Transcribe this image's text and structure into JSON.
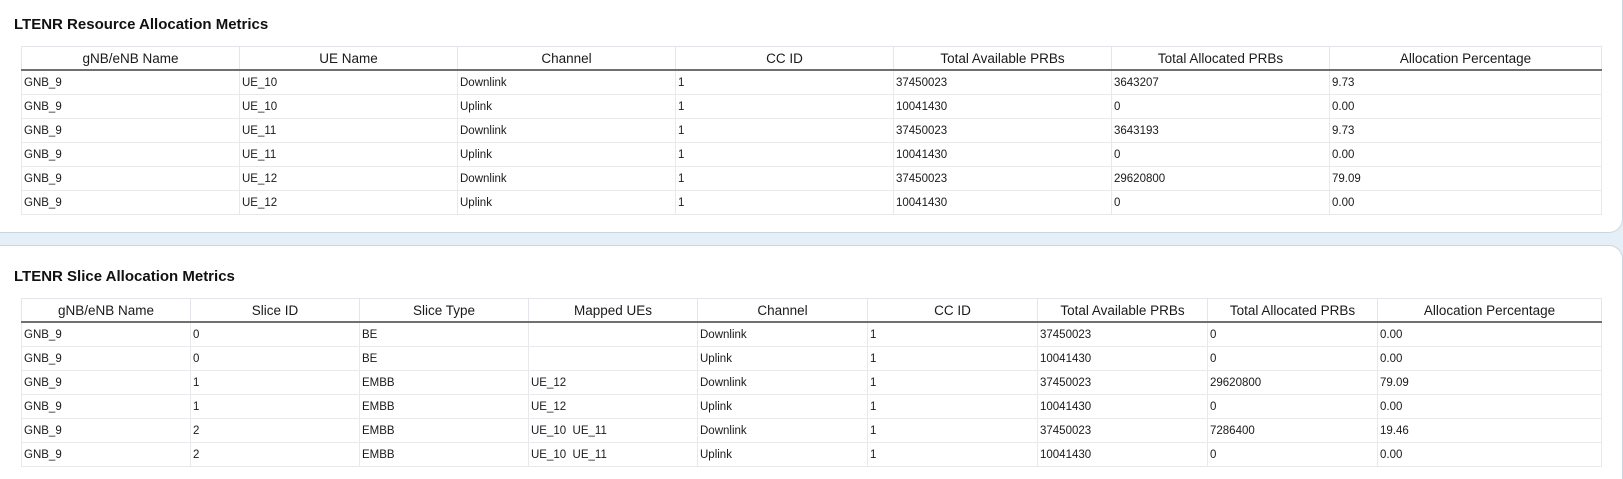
{
  "resource_panel": {
    "title": "LTENR Resource Allocation Metrics",
    "columns": [
      "gNB/eNB Name",
      "UE Name",
      "Channel",
      "CC ID",
      "Total Available PRBs",
      "Total Allocated PRBs",
      "Allocation Percentage"
    ],
    "rows": [
      [
        "GNB_9",
        "UE_10",
        "Downlink",
        "1",
        "37450023",
        "3643207",
        "9.73"
      ],
      [
        "GNB_9",
        "UE_10",
        "Uplink",
        "1",
        "10041430",
        "0",
        "0.00"
      ],
      [
        "GNB_9",
        "UE_11",
        "Downlink",
        "1",
        "37450023",
        "3643193",
        "9.73"
      ],
      [
        "GNB_9",
        "UE_11",
        "Uplink",
        "1",
        "10041430",
        "0",
        "0.00"
      ],
      [
        "GNB_9",
        "UE_12",
        "Downlink",
        "1",
        "37450023",
        "29620800",
        "79.09"
      ],
      [
        "GNB_9",
        "UE_12",
        "Uplink",
        "1",
        "10041430",
        "0",
        "0.00"
      ]
    ]
  },
  "slice_panel": {
    "title": "LTENR Slice Allocation Metrics",
    "columns": [
      "gNB/eNB Name",
      "Slice ID",
      "Slice Type",
      "Mapped UEs",
      "Channel",
      "CC ID",
      "Total Available PRBs",
      "Total Allocated PRBs",
      "Allocation Percentage"
    ],
    "rows": [
      [
        "GNB_9",
        "0",
        "BE",
        "",
        "Downlink",
        "1",
        "37450023",
        "0",
        "0.00"
      ],
      [
        "GNB_9",
        "0",
        "BE",
        "",
        "Uplink",
        "1",
        "10041430",
        "0",
        "0.00"
      ],
      [
        "GNB_9",
        "1",
        "EMBB",
        "UE_12",
        "Downlink",
        "1",
        "37450023",
        "29620800",
        "79.09"
      ],
      [
        "GNB_9",
        "1",
        "EMBB",
        "UE_12",
        "Uplink",
        "1",
        "10041430",
        "0",
        "0.00"
      ],
      [
        "GNB_9",
        "2",
        "EMBB",
        "UE_10  UE_11",
        "Downlink",
        "1",
        "37450023",
        "7286400",
        "19.46"
      ],
      [
        "GNB_9",
        "2",
        "EMBB",
        "UE_10  UE_11",
        "Uplink",
        "1",
        "10041430",
        "0",
        "0.00"
      ]
    ]
  }
}
